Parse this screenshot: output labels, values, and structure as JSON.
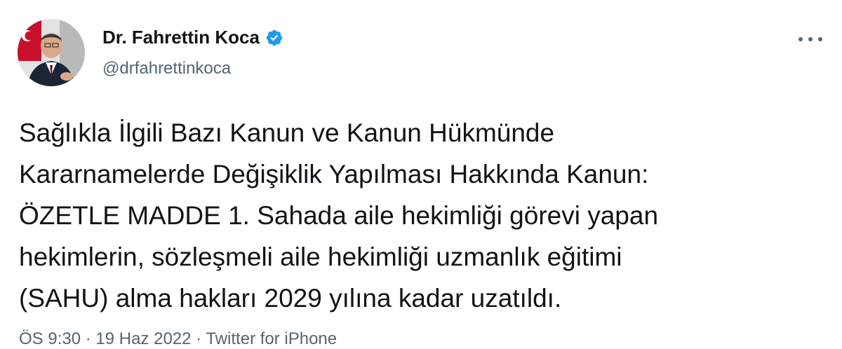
{
  "author": {
    "display_name": "Dr. Fahrettin Koca",
    "handle": "@drfahrettinkoca",
    "verified": true,
    "avatar_icon": "profile-photo"
  },
  "tweet": {
    "lines": [
      "Sağlıkla İlgili Bazı Kanun ve Kanun Hükmünde",
      "Kararnamelerde Değişiklik Yapılması Hakkında Kanun:",
      "ÖZETLE MADDE 1. Sahada aile hekimliği görevi yapan",
      "hekimlerin, sözleşmeli aile hekimliği uzmanlık eğitimi",
      "(SAHU) alma hakları 2029 yılına kadar uzatıldı."
    ],
    "meta": "ÖS 9:30 · 19 Haz 2022 · Twitter for iPhone"
  },
  "colors": {
    "text": "#0f1419",
    "secondary": "#536471",
    "verified": "#1d9bf0"
  }
}
